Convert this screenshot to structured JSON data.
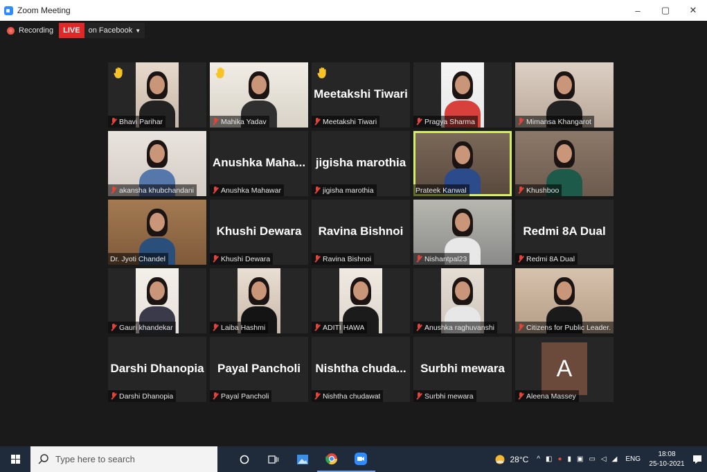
{
  "window": {
    "title": "Zoom Meeting",
    "minimize": "–",
    "restore": "▢",
    "close": "✕"
  },
  "recording": {
    "label": "Recording",
    "live": "LIVE",
    "destination": "on Facebook",
    "caret": "▼"
  },
  "tiles": [
    {
      "name": "Bhavi Parihar",
      "type": "video",
      "hand": true,
      "muted": true
    },
    {
      "name": "Mahika Yadav",
      "type": "video",
      "hand": true,
      "muted": true
    },
    {
      "name": "Meetakshi Tiwari",
      "big": "Meetakshi Tiwari",
      "type": "text",
      "hand": true,
      "muted": true
    },
    {
      "name": "Pragya Sharma",
      "type": "video",
      "muted": true
    },
    {
      "name": "Mimansa Khangarot",
      "type": "video",
      "muted": true
    },
    {
      "name": "akansha khubchandani",
      "type": "video",
      "muted": true
    },
    {
      "name": "Anushka Mahawar",
      "big": "Anushka Maha...",
      "type": "text",
      "muted": true
    },
    {
      "name": "jigisha marothia",
      "big": "jigisha marothia",
      "type": "text",
      "muted": true
    },
    {
      "name": "Prateek Kanwal",
      "type": "video",
      "active": true,
      "muted": false
    },
    {
      "name": "Khushboo",
      "type": "video",
      "muted": true
    },
    {
      "name": "Dr. Jyoti Chandel",
      "type": "video",
      "muted": false
    },
    {
      "name": "Khushi Dewara",
      "big": "Khushi Dewara",
      "type": "text",
      "muted": true
    },
    {
      "name": "Ravina Bishnoi",
      "big": "Ravina Bishnoi",
      "type": "text",
      "muted": true
    },
    {
      "name": "Nishantpal23",
      "type": "video",
      "muted": true
    },
    {
      "name": "Redmi 8A Dual",
      "big": "Redmi 8A Dual",
      "type": "text",
      "muted": true
    },
    {
      "name": "Gauri khandekar",
      "type": "video",
      "muted": true
    },
    {
      "name": "Laiba Hashmi",
      "type": "video",
      "muted": true
    },
    {
      "name": "ADITI HAWA",
      "type": "video",
      "muted": true
    },
    {
      "name": "Anushka raghuvanshi",
      "type": "video",
      "muted": true
    },
    {
      "name": "Citizens for Public Leader...",
      "type": "video",
      "muted": true
    },
    {
      "name": "Darshi Dhanopia",
      "big": "Darshi Dhanopia",
      "type": "text",
      "muted": true
    },
    {
      "name": "Payal Pancholi",
      "big": "Payal Pancholi",
      "type": "text",
      "muted": true
    },
    {
      "name": "Nishtha chudawat",
      "big": "Nishtha chuda...",
      "type": "text",
      "muted": true
    },
    {
      "name": "Surbhi mewara",
      "big": "Surbhi mewara",
      "type": "text",
      "muted": true
    },
    {
      "name": "Aleena Massey",
      "avatar": "A",
      "type": "avatar",
      "muted": true
    }
  ],
  "taskbar": {
    "search_placeholder": "Type here to search",
    "weather": "28°C",
    "language": "ENG",
    "time": "18:08",
    "date": "25-10-2021"
  }
}
